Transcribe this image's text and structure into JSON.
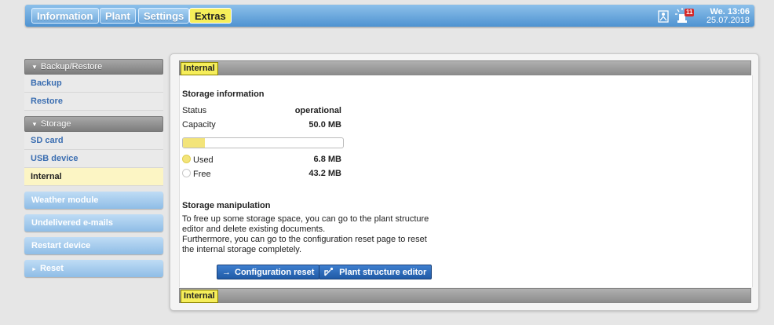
{
  "topnav": {
    "tabs": [
      {
        "label": "Information"
      },
      {
        "label": "Plant"
      },
      {
        "label": "Settings"
      },
      {
        "label": "Extras"
      }
    ],
    "alarm_count": "11",
    "day_time": "We. 13:06",
    "date": "25.07.2018"
  },
  "sidebar": {
    "groups": [
      {
        "label": "Backup/Restore",
        "items": [
          {
            "label": "Backup"
          },
          {
            "label": "Restore"
          }
        ]
      },
      {
        "label": "Storage",
        "items": [
          {
            "label": "SD card"
          },
          {
            "label": "USB device"
          },
          {
            "label": "Internal"
          }
        ]
      }
    ],
    "buttons": [
      {
        "label": "Weather module"
      },
      {
        "label": "Undelivered e-mails"
      },
      {
        "label": "Restart device"
      },
      {
        "label": "Reset"
      }
    ]
  },
  "panel": {
    "tab_label": "Internal",
    "footer_label": "Internal",
    "storage_info": {
      "title": "Storage information",
      "status_label": "Status",
      "status_value": "operational",
      "capacity_label": "Capacity",
      "capacity_value": "50.0 MB",
      "used_fraction": 0.136,
      "used_label": "Used",
      "used_value": "6.8 MB",
      "free_label": "Free",
      "free_value": "43.2 MB"
    },
    "manipulation": {
      "title": "Storage manipulation",
      "text1": "To free up some storage space, you can go to the plant structure editor and delete existing documents.",
      "text2": "Furthermore, you can go to the configuration reset page to reset the internal storage completely.",
      "config_reset_label": "Configuration reset",
      "plant_editor_label": "Plant structure editor"
    }
  },
  "colors": {
    "accent_yellow": "#f6ee5a",
    "used_color": "#f3e47a",
    "nav_blue": "#4f93d1",
    "link_blue": "#3b6eb1"
  },
  "icons": {
    "user": "user-icon",
    "alarm": "alarm-icon",
    "arrow": "arrow-right-icon",
    "editor": "editor-icon"
  }
}
